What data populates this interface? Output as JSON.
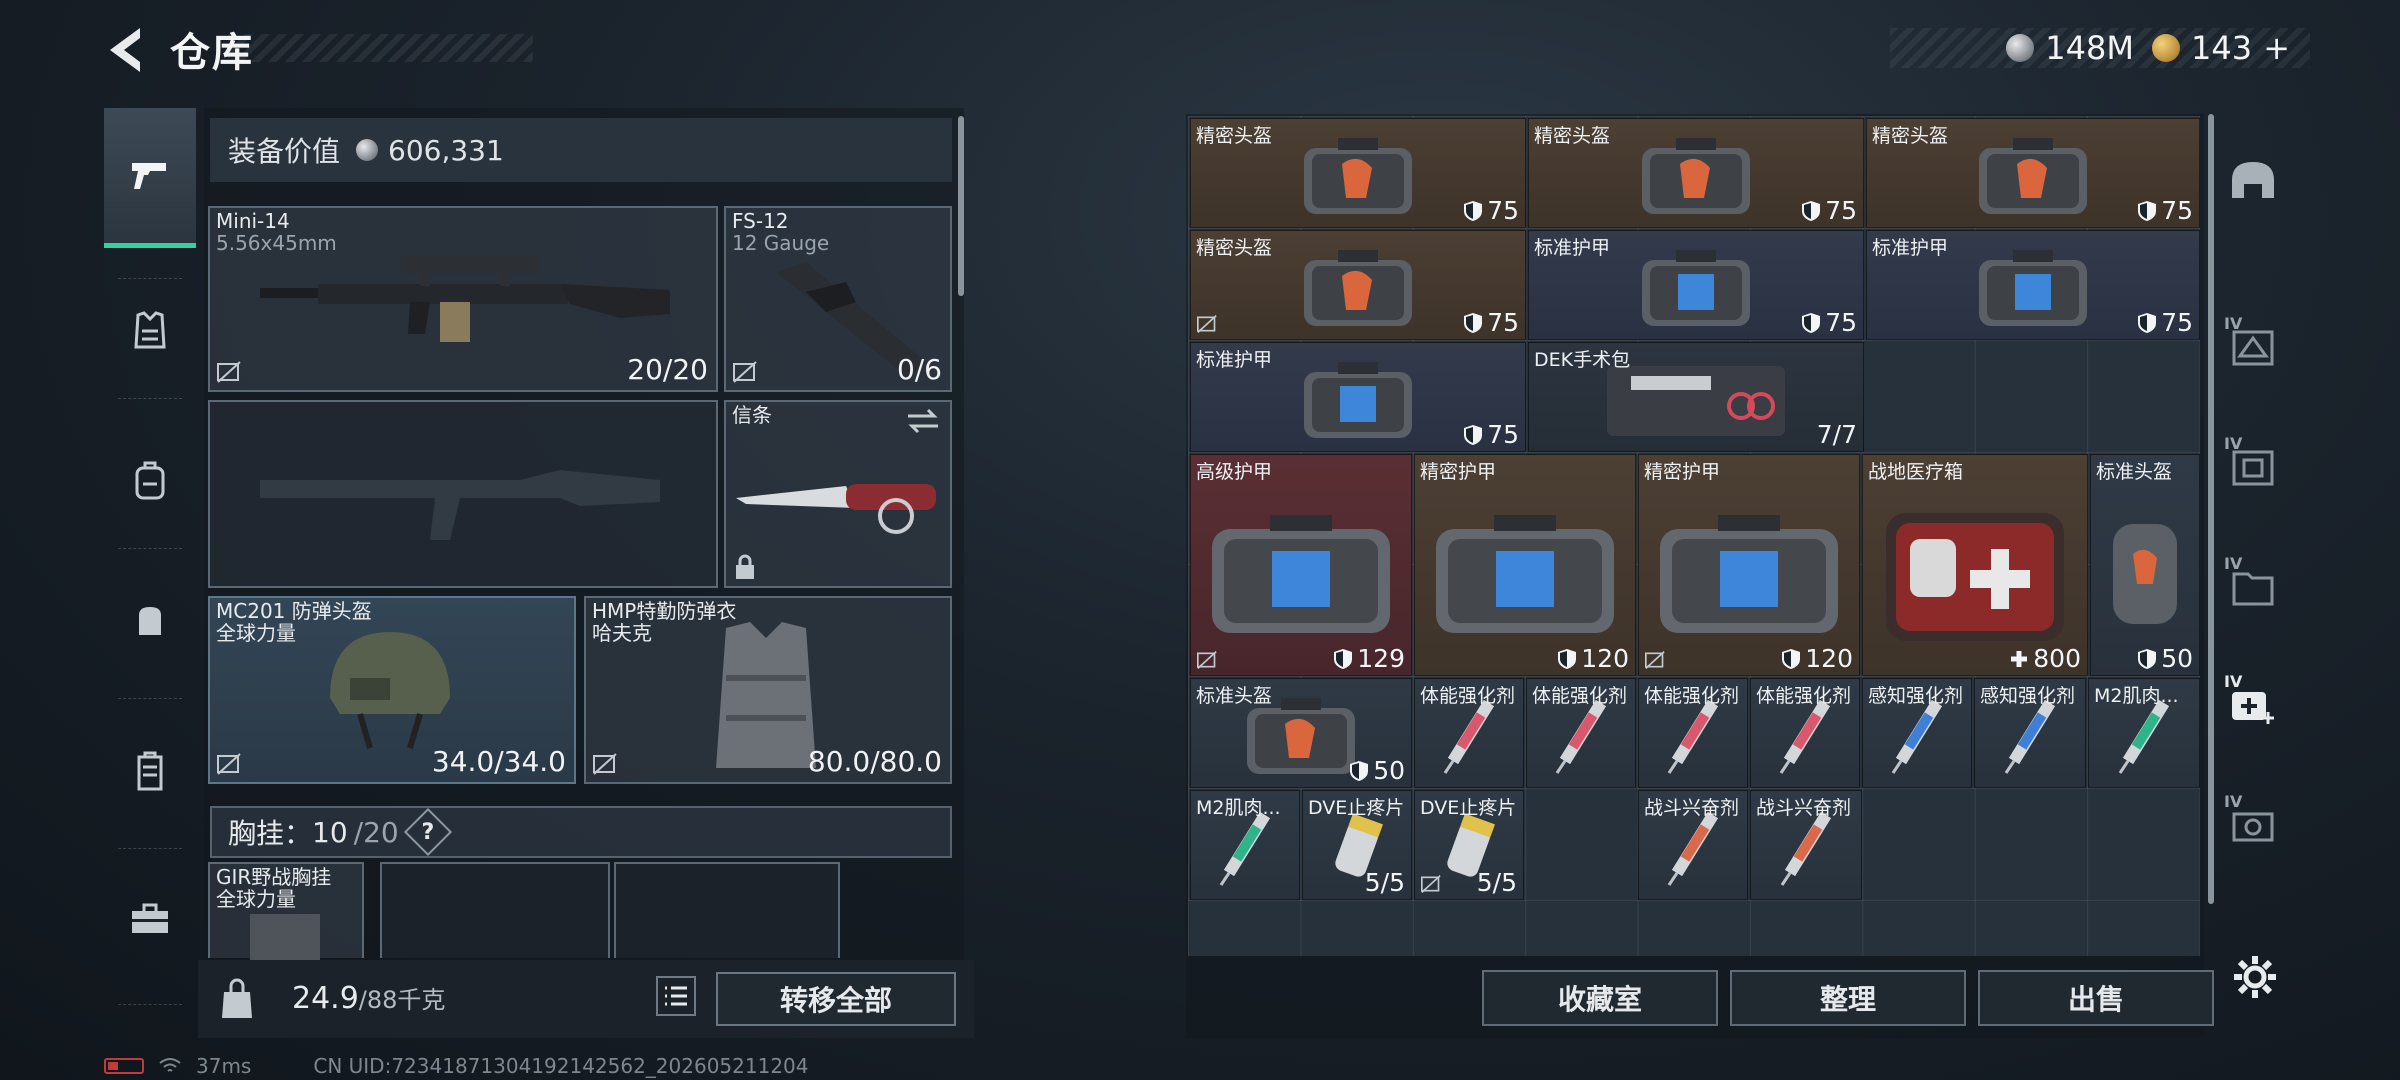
{
  "header": {
    "title": "仓库",
    "silver": "148M",
    "gold": "143"
  },
  "left_nav": [
    "pistol-icon",
    "armor-icon",
    "backpack-icon",
    "pouch-icon",
    "vest-icon",
    "case-icon"
  ],
  "equipment": {
    "value_label": "装备价值",
    "value": "606,331",
    "primary": {
      "name": "Mini-14",
      "ammo": "5.56x45mm",
      "count": "20/20"
    },
    "secondary": {
      "name": "FS-12",
      "ammo": "12 Gauge",
      "count": "0/6"
    },
    "melee": {
      "name": "信条"
    },
    "helmet": {
      "name": "MC201 防弹头盔",
      "maker": "全球力量",
      "durability": "34.0/34.0"
    },
    "armor": {
      "name": "HMP特勤防弹衣",
      "maker": "哈夫克",
      "durability": "80.0/80.0"
    },
    "chest": {
      "label": "胸挂：",
      "used": "10",
      "cap": "/20",
      "help": "?"
    },
    "rig": {
      "name": "GIR野战胸挂",
      "maker": "全球力量"
    },
    "weight": {
      "current": "24.9",
      "cap": "/88千克"
    },
    "transfer_label": "转移全部"
  },
  "status": {
    "ping": "37ms",
    "uid": "CN UID:72341871304192142562_202605211204"
  },
  "storage": {
    "items": [
      {
        "name": "精密头盔",
        "value": "75",
        "icon": "shield"
      },
      {
        "name": "精密头盔",
        "value": "75",
        "icon": "shield"
      },
      {
        "name": "精密头盔",
        "value": "75",
        "icon": "shield"
      },
      {
        "name": "精密头盔",
        "value": "75",
        "icon": "shield"
      },
      {
        "name": "标准护甲",
        "value": "75",
        "icon": "shield"
      },
      {
        "name": "标准护甲",
        "value": "75",
        "icon": "shield"
      },
      {
        "name": "标准护甲",
        "value": "75",
        "icon": "shield"
      },
      {
        "name": "DEK手术包",
        "value": "7/7"
      },
      {
        "name": "高级护甲",
        "value": "129",
        "icon": "shield"
      },
      {
        "name": "精密护甲",
        "value": "120",
        "icon": "shield"
      },
      {
        "name": "精密护甲",
        "value": "120",
        "icon": "shield"
      },
      {
        "name": "战地医疗箱",
        "value": "800",
        "icon": "plus"
      },
      {
        "name": "标准头盔",
        "value": "50",
        "icon": "shield"
      },
      {
        "name": "标准头盔",
        "value": "50",
        "icon": "shield"
      },
      {
        "name": "体能强化剂"
      },
      {
        "name": "体能强化剂"
      },
      {
        "name": "体能强化剂"
      },
      {
        "name": "体能强化剂"
      },
      {
        "name": "感知强化剂"
      },
      {
        "name": "感知强化剂"
      },
      {
        "name": "M2肌肉..."
      },
      {
        "name": "M2肌肉..."
      },
      {
        "name": "DVE止疼片",
        "value": "5/5"
      },
      {
        "name": "DVE止疼片",
        "value": "5/5"
      },
      {
        "name": "战斗兴奋剂"
      },
      {
        "name": "战斗兴奋剂"
      }
    ]
  },
  "right_categories": [
    {
      "icon": "helmet-icon",
      "tier": ""
    },
    {
      "icon": "armor-crate-icon",
      "tier": "IV"
    },
    {
      "icon": "rig-crate-icon",
      "tier": "IV"
    },
    {
      "icon": "folder-crate-icon",
      "tier": "IV"
    },
    {
      "icon": "medkit-crate-icon",
      "tier": "IV"
    },
    {
      "icon": "ammo-crate-icon",
      "tier": "IV"
    }
  ],
  "actions": {
    "collection": "收藏室",
    "sort": "整理",
    "sell": "出售"
  },
  "colors": {
    "accent": "#35d0a0",
    "brown_cell": "#4c3f34",
    "navy_cell": "#323a4c",
    "red_cell": "#5a2f34"
  }
}
